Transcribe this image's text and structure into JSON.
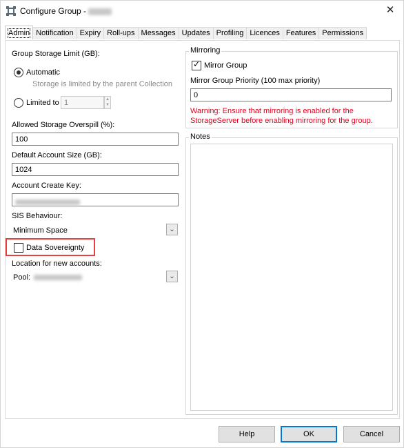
{
  "window": {
    "title": "Configure Group - ",
    "close_glyph": "✕",
    "app_icon": "app-gear-icon"
  },
  "tabs": [
    {
      "label": "Admin",
      "active": true
    },
    {
      "label": "Notification"
    },
    {
      "label": "Expiry"
    },
    {
      "label": "Roll-ups"
    },
    {
      "label": "Messages"
    },
    {
      "label": "Updates"
    },
    {
      "label": "Profiling"
    },
    {
      "label": "Licences"
    },
    {
      "label": "Features"
    },
    {
      "label": "Permissions"
    }
  ],
  "admin": {
    "storage_limit_label": "Group Storage Limit (GB):",
    "automatic_label": "Automatic",
    "automatic_checked": true,
    "automatic_hint": "Storage is limited by the parent Collection",
    "limited_label": "Limited to",
    "limited_value": "1",
    "overspill_label": "Allowed Storage Overspill (%):",
    "overspill_value": "100",
    "default_size_label": "Default Account Size (GB):",
    "default_size_value": "1024",
    "create_key_label": "Account Create Key:",
    "sis_label": "SIS Behaviour:",
    "sis_value": "Minimum Space",
    "sovereignty_label": "Data Sovereignty",
    "sovereignty_checked": false,
    "location_label": "Location for new accounts:",
    "pool_label": "Pool:"
  },
  "mirroring": {
    "group_title": "Mirroring",
    "mirror_group_label": "Mirror Group",
    "mirror_group_checked": true,
    "priority_label": "Mirror Group Priority (100 max priority)",
    "priority_value": "0",
    "warning_line1": "Warning: Ensure that mirroring is enabled for the",
    "warning_line2": "StorageServer before enabling mirroring for the group."
  },
  "notes": {
    "group_title": "Notes",
    "value": ""
  },
  "buttons": {
    "help": "Help",
    "ok": "OK",
    "cancel": "Cancel"
  },
  "colors": {
    "accent": "#0078d7",
    "warning": "#e0001c",
    "highlight": "#e84040"
  }
}
